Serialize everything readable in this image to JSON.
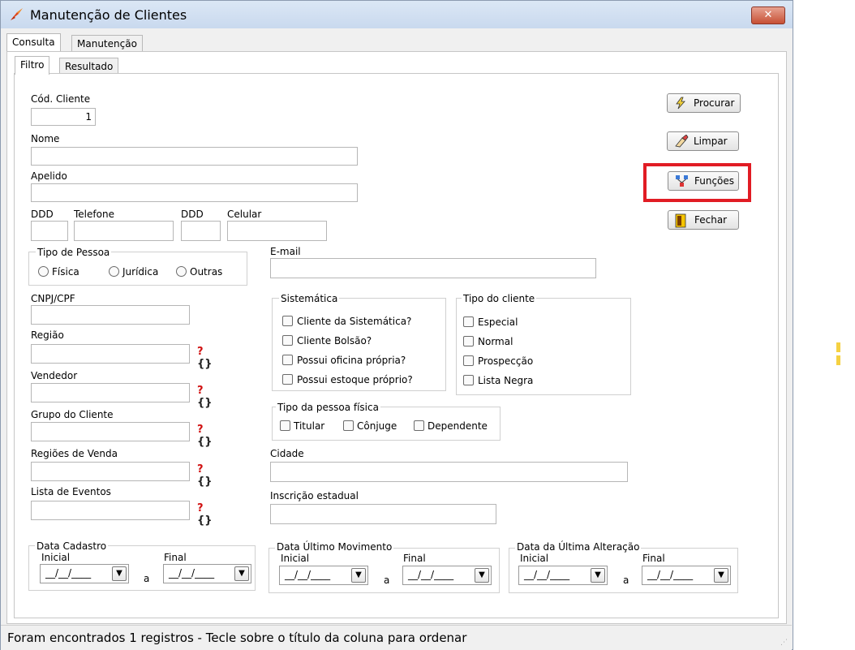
{
  "window": {
    "title": "Manutenção de Clientes",
    "close_glyph": "✕"
  },
  "outer_tabs": [
    "Consulta",
    "Manutenção"
  ],
  "inner_tabs": [
    "Filtro",
    "Resultado"
  ],
  "fields": {
    "cod_cliente": {
      "label": "Cód. Cliente",
      "value": "1"
    },
    "nome": {
      "label": "Nome",
      "value": ""
    },
    "apelido": {
      "label": "Apelido",
      "value": ""
    },
    "ddd1": {
      "label": "DDD",
      "value": ""
    },
    "telefone": {
      "label": "Telefone",
      "value": ""
    },
    "ddd2": {
      "label": "DDD",
      "value": ""
    },
    "celular": {
      "label": "Celular",
      "value": ""
    },
    "email": {
      "label": "E-mail",
      "value": ""
    },
    "cnpj": {
      "label": "CNPJ/CPF",
      "value": ""
    },
    "regiao": {
      "label": "Região",
      "value": ""
    },
    "vendedor": {
      "label": "Vendedor",
      "value": ""
    },
    "grupo": {
      "label": "Grupo do Cliente",
      "value": ""
    },
    "regioes_venda": {
      "label": "Regiões de Venda",
      "value": ""
    },
    "lista_eventos": {
      "label": "Lista de Eventos",
      "value": ""
    },
    "cidade": {
      "label": "Cidade",
      "value": ""
    },
    "inscricao": {
      "label": "Inscrição estadual",
      "value": ""
    }
  },
  "lookup": {
    "q": "?",
    "b": "{}"
  },
  "tipo_pessoa": {
    "title": "Tipo de Pessoa",
    "options": [
      "Física",
      "Jurídica",
      "Outras"
    ]
  },
  "sistematica": {
    "title": "Sistemática",
    "options": [
      "Cliente da Sistemática?",
      "Cliente Bolsão?",
      "Possui oficina própria?",
      "Possui estoque próprio?"
    ]
  },
  "tipo_cliente": {
    "title": "Tipo do cliente",
    "options": [
      "Especial",
      "Normal",
      "Prospecção",
      "Lista Negra"
    ]
  },
  "tipo_pf": {
    "title": "Tipo da pessoa física",
    "options": [
      "Titular",
      "Cônjuge",
      "Dependente"
    ]
  },
  "date_groups": [
    {
      "title": "Data Cadastro",
      "inicial": "Inicial",
      "final": "Final",
      "sep": "a",
      "start": "__/__/____",
      "end": "__/__/____"
    },
    {
      "title": "Data Último Movimento",
      "inicial": "Inicial",
      "final": "Final",
      "sep": "a",
      "start": "__/__/____",
      "end": "__/__/____"
    },
    {
      "title": "Data da Última Alteração",
      "inicial": "Inicial",
      "final": "Final",
      "sep": "a",
      "start": "__/__/____",
      "end": "__/__/____"
    }
  ],
  "buttons": {
    "procurar": "Procurar",
    "limpar": "Limpar",
    "funcoes": "Funções",
    "fechar": "Fechar"
  },
  "status": "Foram encontrados 1 registros  - Tecle sobre o título da coluna para ordenar",
  "icons": [
    "app-logo-icon",
    "close-icon",
    "lightning-icon",
    "eraser-icon",
    "functions-icon",
    "door-exit-icon",
    "lookup-icon",
    "calendar-dropdown-icon"
  ],
  "colors": {
    "highlight": "#e11c24",
    "lookup_q": "#d01010",
    "titlebar": "#dbe7f5"
  }
}
